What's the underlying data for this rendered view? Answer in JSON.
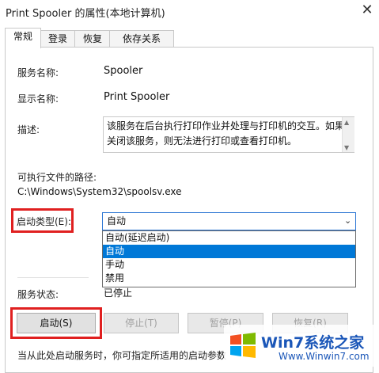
{
  "window": {
    "title": "Print Spooler 的属性(本地计算机)",
    "close_glyph": "✕"
  },
  "tabs": [
    {
      "label": "常规"
    },
    {
      "label": "登录"
    },
    {
      "label": "恢复"
    },
    {
      "label": "依存关系"
    }
  ],
  "fields": {
    "service_name_label": "服务名称:",
    "service_name_value": "Spooler",
    "display_name_label": "显示名称:",
    "display_name_value": "Print Spooler",
    "description_label": "描述:",
    "description_value": "该服务在后台执行打印作业并处理与打印机的交互。如果关闭该服务，则无法进行打印或查看打印机。",
    "exe_path_label": "可执行文件的路径:",
    "exe_path_value": "C:\\Windows\\System32\\spoolsv.exe",
    "startup_type_label": "启动类型(E):",
    "startup_type_value": "自动",
    "startup_options": [
      "自动(延迟启动)",
      "自动",
      "手动",
      "禁用"
    ],
    "service_status_label": "服务状态:",
    "service_status_value": "已停止"
  },
  "buttons": {
    "start": "启动(S)",
    "stop": "停止(T)",
    "pause": "暂停(P)",
    "resume": "恢复(R)"
  },
  "footer": {
    "hint": "当从此处启动服务时，你可指定所适用的启动参数"
  },
  "watermark": {
    "brand": "Win7系统之家",
    "url": "Www.Winwin7.com"
  },
  "colors": {
    "accent": "#0078d7",
    "highlight_red": "#e02020",
    "watermark_blue": "#1a56b8"
  }
}
